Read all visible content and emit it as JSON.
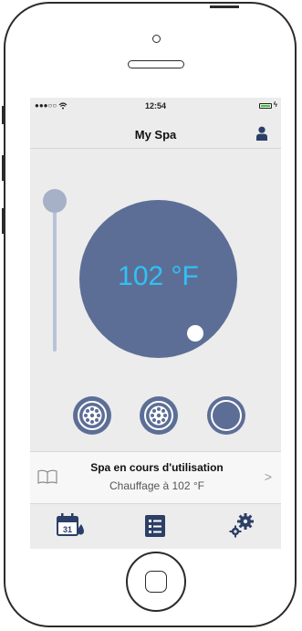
{
  "statusbar": {
    "signal": "●●●○○",
    "time": "12:54"
  },
  "navbar": {
    "title": "My Spa",
    "account_icon": "person-icon"
  },
  "thermostat": {
    "temperature": "102 °F",
    "slider_level": 0.9,
    "dial_color": "#5d6e96",
    "temp_color": "#2ec2f5"
  },
  "jets": [
    {
      "icon": "jets-icon",
      "state": "active"
    },
    {
      "icon": "jets-icon",
      "state": "active"
    },
    {
      "icon": "light-icon",
      "state": "off"
    }
  ],
  "status_panel": {
    "title": "Spa en cours d'utilisation",
    "subtitle": "Chauffage à 102 °F",
    "icon": "book-icon"
  },
  "toolbar": {
    "calendar_day": "31",
    "items": [
      "calendar-icon",
      "list-icon",
      "settings-gears-icon"
    ]
  }
}
